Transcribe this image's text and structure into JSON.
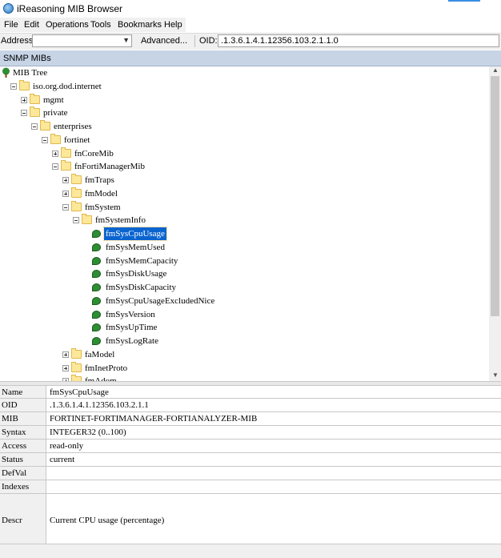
{
  "window": {
    "title": "iReasoning MIB Browser"
  },
  "menu": [
    "File",
    "Edit",
    "Operations",
    "Tools",
    "Bookmarks",
    "Help"
  ],
  "toolbar": {
    "address_label": "Address:",
    "address_value": "",
    "advanced_label": "Advanced...",
    "oid_label": "OID:",
    "oid_value": ".1.3.6.1.4.1.12356.103.2.1.1.0"
  },
  "panel": {
    "title": "SNMP MIBs"
  },
  "tree": [
    {
      "label": "MIB Tree",
      "kind": "root"
    },
    {
      "label": "iso.org.dod.internet",
      "kind": "folder",
      "exp": "minus"
    },
    {
      "label": "mgmt",
      "kind": "folder",
      "exp": "plus"
    },
    {
      "label": "private",
      "kind": "folder",
      "exp": "minus"
    },
    {
      "label": "enterprises",
      "kind": "folder",
      "exp": "minus"
    },
    {
      "label": "fortinet",
      "kind": "folder",
      "exp": "minus"
    },
    {
      "label": "fnCoreMib",
      "kind": "folder",
      "exp": "plus"
    },
    {
      "label": "fnFortiManagerMib",
      "kind": "folder",
      "exp": "minus"
    },
    {
      "label": "fmTraps",
      "kind": "folder",
      "exp": "plus"
    },
    {
      "label": "fmModel",
      "kind": "folder",
      "exp": "plus"
    },
    {
      "label": "fmSystem",
      "kind": "folder",
      "exp": "minus"
    },
    {
      "label": "fmSystemInfo",
      "kind": "folder",
      "exp": "minus"
    },
    {
      "label": "fmSysCpuUsage",
      "kind": "leaf",
      "selected": true
    },
    {
      "label": "fmSysMemUsed",
      "kind": "leaf"
    },
    {
      "label": "fmSysMemCapacity",
      "kind": "leaf"
    },
    {
      "label": "fmSysDiskUsage",
      "kind": "leaf"
    },
    {
      "label": "fmSysDiskCapacity",
      "kind": "leaf"
    },
    {
      "label": "fmSysCpuUsageExcludedNice",
      "kind": "leaf"
    },
    {
      "label": "fmSysVersion",
      "kind": "leaf"
    },
    {
      "label": "fmSysUpTime",
      "kind": "leaf"
    },
    {
      "label": "fmSysLogRate",
      "kind": "leaf"
    },
    {
      "label": "faModel",
      "kind": "folder",
      "exp": "plus"
    },
    {
      "label": "fmInetProto",
      "kind": "folder",
      "exp": "plus"
    },
    {
      "label": "fmAdom",
      "kind": "folder",
      "exp": "plus"
    }
  ],
  "props": [
    {
      "key": "Name",
      "value": "fmSysCpuUsage"
    },
    {
      "key": "OID",
      "value": ".1.3.6.1.4.1.12356.103.2.1.1"
    },
    {
      "key": "MIB",
      "value": "FORTINET-FORTIMANAGER-FORTIANALYZER-MIB"
    },
    {
      "key": "Syntax",
      "value": "INTEGER32 (0..100)"
    },
    {
      "key": "Access",
      "value": "read-only"
    },
    {
      "key": "Status",
      "value": "current"
    },
    {
      "key": "DefVal",
      "value": ""
    },
    {
      "key": "Indexes",
      "value": ""
    },
    {
      "key": "Descr",
      "value": "Current CPU usage (percentage)"
    }
  ]
}
